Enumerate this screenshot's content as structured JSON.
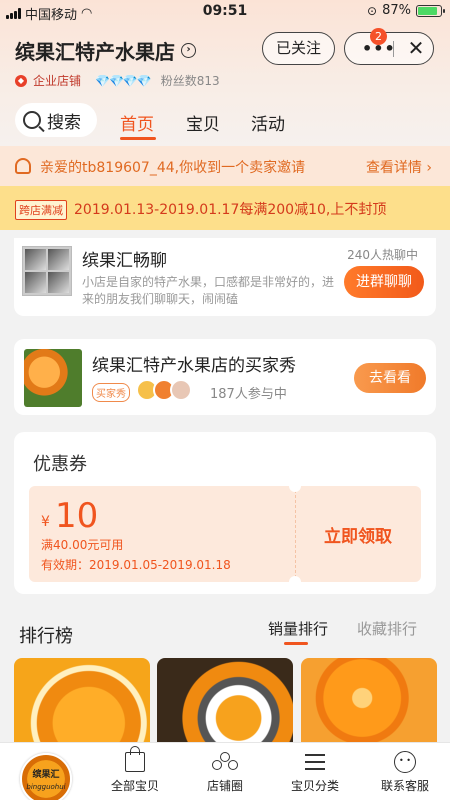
{
  "status_bar": {
    "carrier": "中国移动",
    "time": "09:51",
    "battery": "87%",
    "battery_level": 0.87
  },
  "shop": {
    "name": "缤果汇特产水果店",
    "follow_label": "已关注",
    "notification_count": "2",
    "enterprise_label": "企业店铺",
    "diamonds": "💎💎💎💎",
    "fans": "粉丝数813"
  },
  "nav": {
    "search_label": "搜索",
    "tabs": [
      "首页",
      "宝贝",
      "活动"
    ],
    "active_tab": 0
  },
  "invite": {
    "text": "亲爱的tb819607_44,你收到一个卖家邀请",
    "link": "查看详情 ›"
  },
  "promo": {
    "tag": "跨店满减",
    "text": "2019.01.13-2019.01.17每满200减10,上不封顶"
  },
  "chat": {
    "title": "缤果汇畅聊",
    "description": "小店是自家的特产水果，口感都是非常好的，进来的朋友我们聊聊天，闹闹磕",
    "hot_count": "240人热聊中",
    "join_label": "进群聊聊"
  },
  "buyer_show": {
    "title": "缤果汇特产水果店的买家秀",
    "tag": "买家秀",
    "participants": "187人参与中",
    "button": "去看看"
  },
  "coupon": {
    "title": "优惠券",
    "currency": "¥",
    "amount": "10",
    "condition": "满40.00元可用",
    "validity": "有效期：2019.01.05-2019.01.18",
    "claim_label": "立即领取"
  },
  "ranking": {
    "title": "排行榜",
    "tabs": [
      "销量排行",
      "收藏排行"
    ],
    "active_tab": 0
  },
  "tabbar": {
    "logo_text": "缤果汇",
    "logo_sub": "bingguohui",
    "items": [
      "全部宝贝",
      "店铺圈",
      "宝贝分类",
      "联系客服"
    ]
  }
}
